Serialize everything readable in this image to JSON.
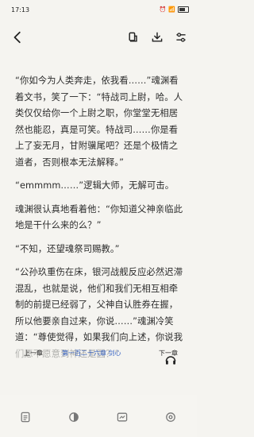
{
  "status": {
    "time": "17:13"
  },
  "reader": {
    "paragraphs": [
      "“你如今为人类奔走，依我看……”魂渊看着文书，笑了一下：“特战司上尉，哈。人类仅仅给你一个上尉之职，你堂堂无相居然也能忍，真是可笑。特战司……你是看上了妄无月，甘附骥尾吧？还是个极情之道者，否则根本无法解释。”",
      "“emmmm……”逻辑大师，无解可击。",
      "魂渊很认真地看着他：“你知道父神亲临此地是干什么来的么？”",
      "“不知，还望魂祭司赐教。”",
      "“公孙玖重伤在床，银河战舰反应必然迟滞混乱，也就是说，他们和我们无相互相牵制的前提已经弱了，父神自认胜券在握，所以他要亲自过来，你说……”魂渊冷笑道：“尊使觉得，如果我们向上述，你说我们愿不愿意到神还是圆？”"
    ]
  },
  "chapter_bar": {
    "prev_label": "上一章",
    "chapter_title": "第一百二十六章 剑心",
    "next_label": "下一章"
  }
}
